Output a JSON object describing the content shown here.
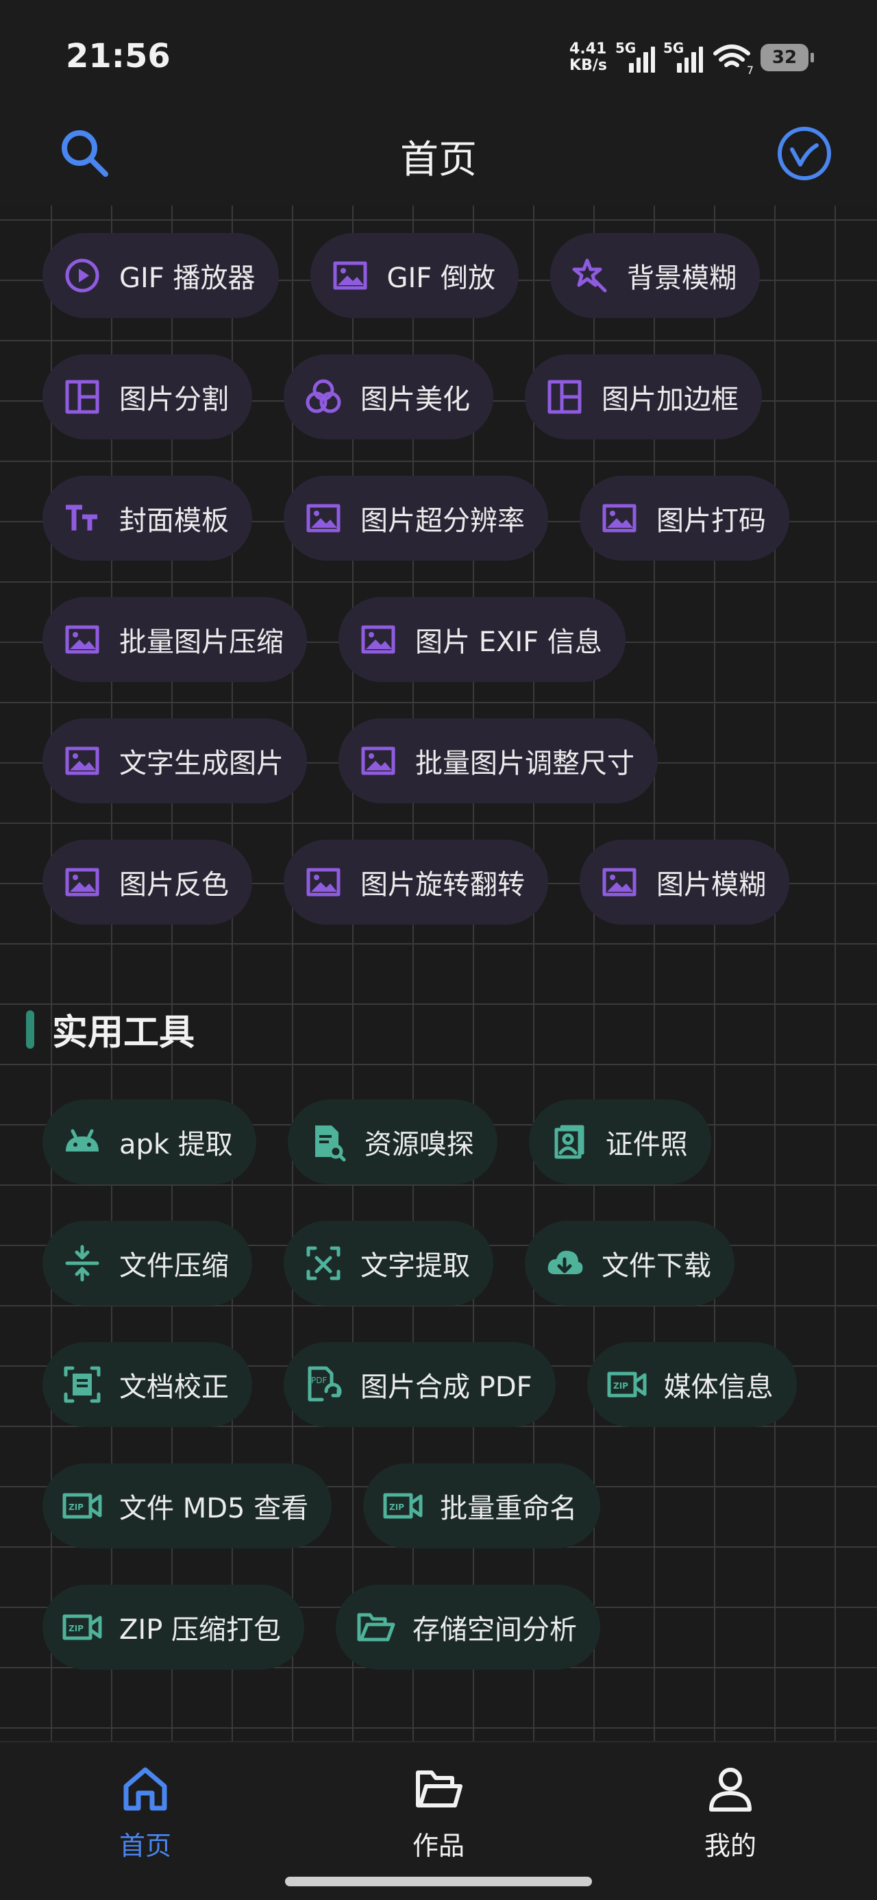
{
  "status_bar": {
    "time": "21:56",
    "net_speed_value": "4.41",
    "net_speed_unit": "KB/s",
    "signal1_label": "5G",
    "signal2_label": "5G",
    "wifi_label": "7",
    "battery": "32"
  },
  "header": {
    "title": "首页"
  },
  "image_tools": [
    [
      "GIF 播放器",
      "GIF 倒放",
      "背景模糊"
    ],
    [
      "图片分割",
      "图片美化",
      "图片加边框"
    ],
    [
      "封面模板",
      "图片超分辨率",
      "图片打码"
    ],
    [
      "批量图片压缩",
      "图片 EXIF 信息"
    ],
    [
      "文字生成图片",
      "批量图片调整尺寸"
    ],
    [
      "图片反色",
      "图片旋转翻转",
      "图片模糊"
    ]
  ],
  "image_tool_icons": [
    [
      "play-circle-icon",
      "image-icon",
      "magic-star-icon"
    ],
    [
      "layout-split-icon",
      "color-filter-icon",
      "layout-split-icon"
    ],
    [
      "text-format-icon",
      "image-icon",
      "image-icon"
    ],
    [
      "image-icon",
      "image-icon"
    ],
    [
      "image-icon",
      "image-icon"
    ],
    [
      "image-icon",
      "image-icon",
      "image-icon"
    ]
  ],
  "section": {
    "title": "实用工具"
  },
  "utility_tools": [
    [
      "apk 提取",
      "资源嗅探",
      "证件照"
    ],
    [
      "文件压缩",
      "文字提取",
      "文件下载"
    ],
    [
      "文档校正",
      "图片合成 PDF",
      "媒体信息"
    ],
    [
      "文件 MD5 查看",
      "批量重命名"
    ],
    [
      "ZIP 压缩打包",
      "存储空间分析"
    ]
  ],
  "utility_tool_icons": [
    [
      "android-icon",
      "file-search-icon",
      "id-photo-icon"
    ],
    [
      "compress-icon",
      "text-scan-icon",
      "cloud-download-icon"
    ],
    [
      "document-scan-icon",
      "pdf-icon",
      "zip-video-icon"
    ],
    [
      "zip-video-icon",
      "zip-video-icon"
    ],
    [
      "zip-video-icon",
      "folder-open-icon"
    ]
  ],
  "colors": {
    "purple_accent": "#8f5ce0",
    "teal_accent": "#4fb39b",
    "nav_active": "#4a86f0"
  },
  "bottom_nav": {
    "home": "首页",
    "works": "作品",
    "mine": "我的"
  }
}
